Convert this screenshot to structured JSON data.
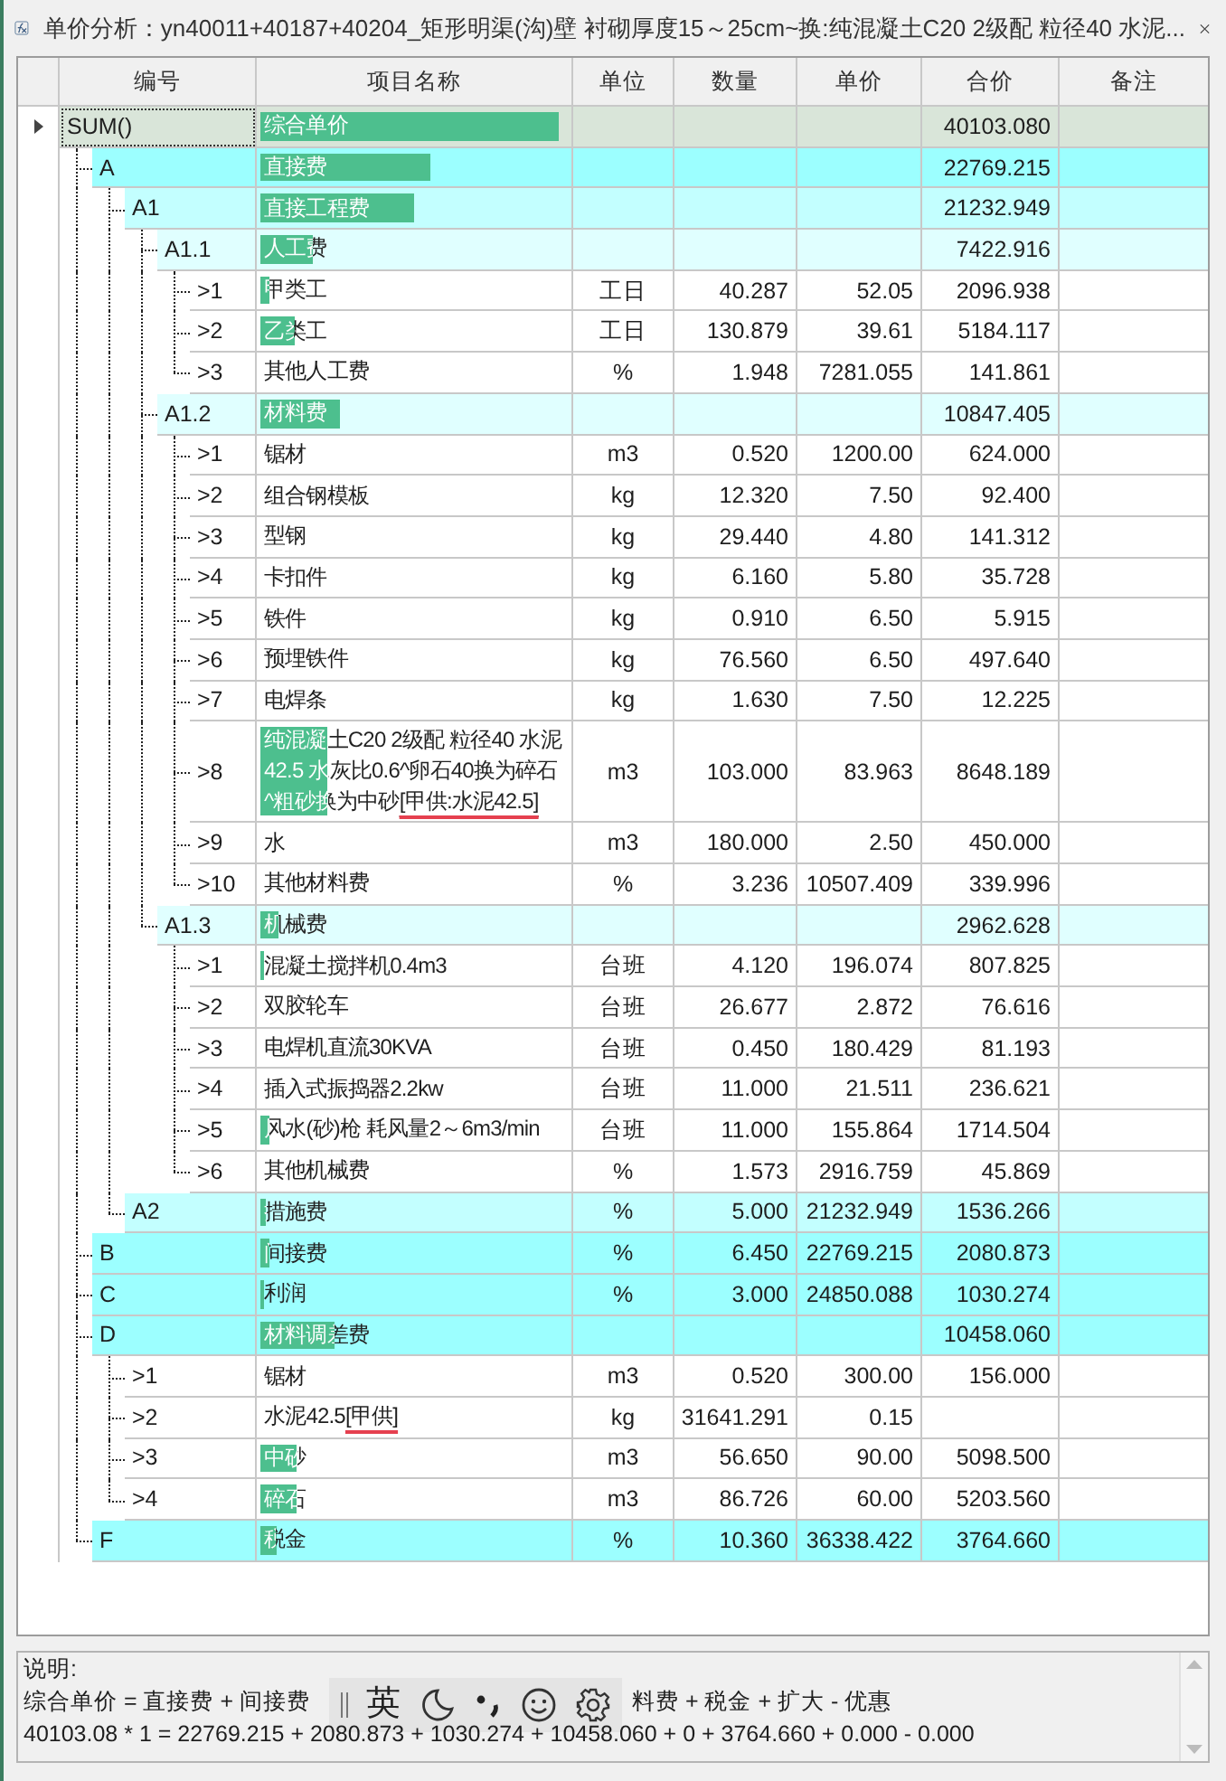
{
  "window": {
    "title": "单价分析：yn40011+40187+40204_矩形明渠(沟)壁 衬砌厚度15～25cm~换:纯混凝土C20 2级配 粒径40 水泥..."
  },
  "columns": [
    "编号",
    "项目名称",
    "单位",
    "数量",
    "单价",
    "合价",
    "备注"
  ],
  "rows": [
    {
      "code": "SUM()",
      "name": "综合单价",
      "total": "40103.080",
      "level": 0.97,
      "kind": "group",
      "selected": true,
      "children": [
        {
          "code": "A",
          "name": "直接费",
          "total": "22769.215",
          "level": 0.55,
          "kind": "group",
          "selected": false,
          "children": [
            {
              "code": "A1",
              "name": "直接工程费",
              "total": "21232.949",
              "level": 0.5,
              "kind": "group",
              "selected": false,
              "children": [
                {
                  "code": "A1.1",
                  "name": "人工费",
                  "total": "7422.916",
                  "level": 0.17,
                  "kind": "group",
                  "selected": false,
                  "children": [
                    {
                      "code": ">1",
                      "name": "甲类工",
                      "unit": "工日",
                      "quantity": "40.287",
                      "price": "52.05",
                      "total": "2096.938",
                      "level": 0.03,
                      "kind": "item",
                      "selected": false
                    },
                    {
                      "code": ">2",
                      "name": "乙类工",
                      "unit": "工日",
                      "quantity": "130.879",
                      "price": "39.61",
                      "total": "5184.117",
                      "level": 0.11,
                      "kind": "item",
                      "selected": false
                    },
                    {
                      "code": ">3",
                      "name": "其他人工费",
                      "unit": "%",
                      "quantity": "1.948",
                      "price": "7281.055",
                      "total": "141.861",
                      "kind": "item",
                      "selected": false
                    }
                  ]
                },
                {
                  "code": "A1.2",
                  "name": "材料费",
                  "total": "10847.405",
                  "level": 0.26,
                  "kind": "group",
                  "selected": false,
                  "children": [
                    {
                      "code": ">1",
                      "name": "锯材",
                      "unit": "m3",
                      "quantity": "0.520",
                      "price": "1200.00",
                      "total": "624.000",
                      "kind": "item",
                      "selected": false
                    },
                    {
                      "code": ">2",
                      "name": "组合钢模板",
                      "unit": "kg",
                      "quantity": "12.320",
                      "price": "7.50",
                      "total": "92.400",
                      "kind": "item",
                      "selected": false
                    },
                    {
                      "code": ">3",
                      "name": "型钢",
                      "unit": "kg",
                      "quantity": "29.440",
                      "price": "4.80",
                      "total": "141.312",
                      "kind": "item",
                      "selected": false
                    },
                    {
                      "code": ">4",
                      "name": "卡扣件",
                      "unit": "kg",
                      "quantity": "6.160",
                      "price": "5.80",
                      "total": "35.728",
                      "kind": "item",
                      "selected": false
                    },
                    {
                      "code": ">5",
                      "name": "铁件",
                      "unit": "kg",
                      "quantity": "0.910",
                      "price": "6.50",
                      "total": "5.915",
                      "kind": "item",
                      "selected": false
                    },
                    {
                      "code": ">6",
                      "name": "预埋铁件",
                      "unit": "kg",
                      "quantity": "76.560",
                      "price": "6.50",
                      "total": "497.640",
                      "kind": "item",
                      "selected": false
                    },
                    {
                      "code": ">7",
                      "name": "电焊条",
                      "unit": "kg",
                      "quantity": "1.630",
                      "price": "7.50",
                      "total": "12.225",
                      "kind": "item",
                      "selected": false
                    },
                    {
                      "code": ">8",
                      "name": "纯混凝土C20 2级配 粒径40 水泥42.5 水灰比0.6^卵石40换为碎石^粗砂换为中砂",
                      "flag": "[甲供:水泥42.5]",
                      "unit": "m3",
                      "quantity": "103.000",
                      "price": "83.963",
                      "total": "8648.189",
                      "level": 0.22,
                      "kind": "item",
                      "selected": false
                    },
                    {
                      "code": ">9",
                      "name": "水",
                      "unit": "m3",
                      "quantity": "180.000",
                      "price": "2.50",
                      "total": "450.000",
                      "kind": "item",
                      "selected": false
                    },
                    {
                      "code": ">10",
                      "name": "其他材料费",
                      "unit": "%",
                      "quantity": "3.236",
                      "price": "10507.409",
                      "total": "339.996",
                      "kind": "item",
                      "selected": false
                    }
                  ]
                },
                {
                  "code": "A1.3",
                  "name": "机械费",
                  "total": "2962.628",
                  "level": 0.06,
                  "kind": "group",
                  "selected": false,
                  "children": [
                    {
                      "code": ">1",
                      "name": "混凝土搅拌机0.4m3",
                      "unit": "台班",
                      "quantity": "4.120",
                      "price": "196.074",
                      "total": "807.825",
                      "level": 0.01,
                      "kind": "item",
                      "selected": false
                    },
                    {
                      "code": ">2",
                      "name": "双胶轮车",
                      "unit": "台班",
                      "quantity": "26.677",
                      "price": "2.872",
                      "total": "76.616",
                      "kind": "item",
                      "selected": false
                    },
                    {
                      "code": ">3",
                      "name": "电焊机直流30KVA",
                      "unit": "台班",
                      "quantity": "0.450",
                      "price": "180.429",
                      "total": "81.193",
                      "kind": "item",
                      "selected": false
                    },
                    {
                      "code": ">4",
                      "name": "插入式振捣器2.2kw",
                      "unit": "台班",
                      "quantity": "11.000",
                      "price": "21.511",
                      "total": "236.621",
                      "kind": "item",
                      "selected": false
                    },
                    {
                      "code": ">5",
                      "name": "风水(砂)枪 耗风量2～6m3/min",
                      "unit": "台班",
                      "quantity": "11.000",
                      "price": "155.864",
                      "total": "1714.504",
                      "level": 0.03,
                      "kind": "item",
                      "selected": false
                    },
                    {
                      "code": ">6",
                      "name": "其他机械费",
                      "unit": "%",
                      "quantity": "1.573",
                      "price": "2916.759",
                      "total": "45.869",
                      "kind": "item",
                      "selected": false
                    }
                  ]
                }
              ]
            },
            {
              "code": "A2",
              "name": "措施费",
              "unit": "%",
              "quantity": "5.000",
              "price": "21232.949",
              "total": "1536.266",
              "level": 0.02,
              "kind": "group",
              "selected": false
            }
          ]
        },
        {
          "code": "B",
          "name": "间接费",
          "unit": "%",
          "quantity": "6.450",
          "price": "22769.215",
          "total": "2080.873",
          "level": 0.03,
          "kind": "group",
          "selected": false
        },
        {
          "code": "C",
          "name": "利润",
          "unit": "%",
          "quantity": "3.000",
          "price": "24850.088",
          "total": "1030.274",
          "level": 0.01,
          "kind": "group",
          "selected": false
        },
        {
          "code": "D",
          "name": "材料调差费",
          "total": "10458.060",
          "level": 0.24,
          "kind": "group",
          "selected": false,
          "children": [
            {
              "code": ">1",
              "name": "锯材",
              "unit": "m3",
              "quantity": "0.520",
              "price": "300.00",
              "total": "156.000",
              "kind": "item",
              "selected": false
            },
            {
              "code": ">2",
              "name": "水泥42.5",
              "flag": "[甲供]",
              "unit": "kg",
              "quantity": "31641.291",
              "price": "0.15",
              "kind": "item",
              "selected": false
            },
            {
              "code": ">3",
              "name": "中砂",
              "unit": "m3",
              "quantity": "56.650",
              "price": "90.00",
              "total": "5098.500",
              "level": 0.12,
              "kind": "item",
              "selected": false
            },
            {
              "code": ">4",
              "name": "碎石",
              "unit": "m3",
              "quantity": "86.726",
              "price": "60.00",
              "total": "5203.560",
              "level": 0.12,
              "kind": "item",
              "selected": false
            }
          ]
        },
        {
          "code": "F",
          "name": "税金",
          "unit": "%",
          "quantity": "10.360",
          "price": "36338.422",
          "total": "3764.660",
          "level": 0.05,
          "kind": "group",
          "selected": false
        }
      ]
    }
  ],
  "notes": {
    "label": "说明:",
    "formula_left": "综合单价 = 直接费 + 间接费",
    "formula_right": "料费 + 税金 + 扩大 - 优惠",
    "calculation": "40103.08 * 1 = 22769.215 + 2080.873 + 1030.274 + 10458.060 + 0 + 3764.660 + 0.000 - 0.000"
  },
  "ime_toolbar": {
    "mode": "英"
  }
}
